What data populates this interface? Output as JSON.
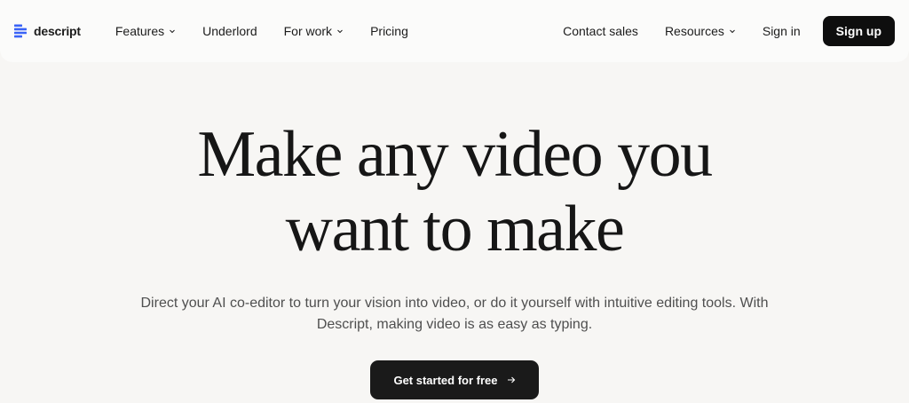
{
  "brand": {
    "name": "descript",
    "accent": "#3a63f6"
  },
  "nav": {
    "items": [
      {
        "label": "Features",
        "has_dropdown": true
      },
      {
        "label": "Underlord",
        "has_dropdown": false
      },
      {
        "label": "For work",
        "has_dropdown": true
      },
      {
        "label": "Pricing",
        "has_dropdown": false
      }
    ],
    "right": {
      "contact_label": "Contact sales",
      "resources_label": "Resources",
      "signin_label": "Sign in",
      "signup_label": "Sign up"
    }
  },
  "hero": {
    "headline_line1": "Make any video you",
    "headline_line2": "want to make",
    "subtext_line1": "Direct your AI co-editor to turn your vision into video, or do it yourself with intuitive editing tools. With",
    "subtext_line2": "Descript, making video is as easy as typing.",
    "cta_label": "Get started for free",
    "cta_icon": "arrow-right-icon"
  },
  "colors": {
    "background": "#f7f6f4",
    "navbar": "#fbfbfa",
    "button_dark": "#0e0e0e",
    "text": "#1c1c1c"
  }
}
